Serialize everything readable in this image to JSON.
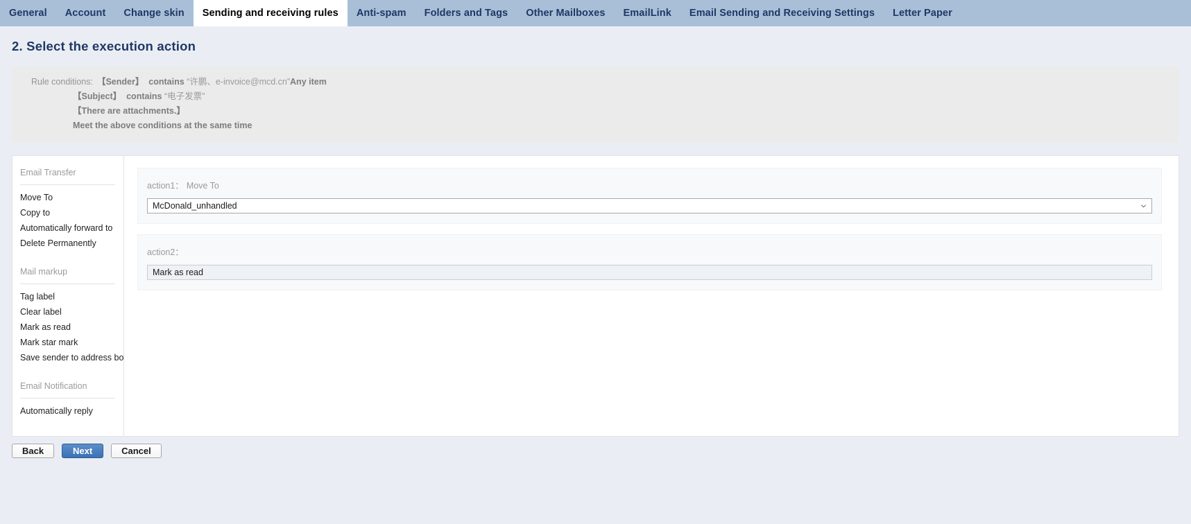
{
  "tabs": [
    {
      "label": "General",
      "active": false
    },
    {
      "label": "Account",
      "active": false
    },
    {
      "label": "Change skin",
      "active": false
    },
    {
      "label": "Sending and receiving rules",
      "active": true
    },
    {
      "label": "Anti-spam",
      "active": false
    },
    {
      "label": "Folders and Tags",
      "active": false
    },
    {
      "label": "Other Mailboxes",
      "active": false
    },
    {
      "label": "EmailLink",
      "active": false
    },
    {
      "label": "Email Sending and Receiving Settings",
      "active": false
    },
    {
      "label": "Letter Paper",
      "active": false
    }
  ],
  "page": {
    "heading": "2. Select the execution action"
  },
  "rule_conditions": {
    "label": "Rule conditions:",
    "line1_field": "【Sender】",
    "line1_operator": "contains",
    "line1_value": "“许鹏、e-invoice@mcd.cn”",
    "line1_suffix": "Any item",
    "line2_field": "【Subject】",
    "line2_operator": "contains",
    "line2_value": "“电子发票”",
    "line3": "【There are attachments.】",
    "line4": "Meet the above conditions at the same time"
  },
  "sidebar": {
    "groups": [
      {
        "title": "Email Transfer",
        "items": [
          "Move To",
          "Copy to",
          "Automatically forward to",
          "Delete Permanently"
        ]
      },
      {
        "title": "Mail markup",
        "items": [
          "Tag label",
          "Clear label",
          "Mark as read",
          "Mark star mark",
          "Save sender to address book"
        ]
      },
      {
        "title": "Email Notification",
        "items": [
          "Automatically reply"
        ]
      }
    ]
  },
  "actions": [
    {
      "label": "action1：",
      "value": "Move To",
      "control": "select",
      "control_value": "McDonald_unhandled"
    },
    {
      "label": "action2：",
      "value": "",
      "control": "text",
      "control_value": "Mark as read"
    }
  ],
  "footer": {
    "back_label": "Back",
    "next_label": "Next",
    "cancel_label": "Cancel"
  },
  "colors": {
    "tabbar_bg": "#a9bfd8",
    "tab_text": "#1f3864",
    "page_bg": "#eaeef4",
    "heading": "#1f3864",
    "rulebox_bg": "#ebebeb",
    "primary_button": "#3b72b4"
  }
}
